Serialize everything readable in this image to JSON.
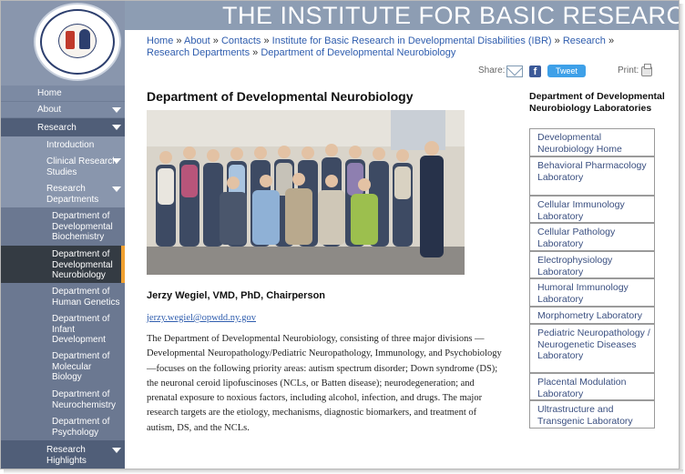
{
  "header": {
    "title": "THE INSTITUTE FOR BASIC RESEARCH"
  },
  "logo": {
    "text": "EDUCATION · RESEARCH · SERVICE · OPWDD"
  },
  "sidebar": {
    "items": [
      {
        "label": "Home"
      },
      {
        "label": "About"
      },
      {
        "label": "Research"
      },
      {
        "label": "Introduction"
      },
      {
        "label": "Clinical Research Studies"
      },
      {
        "label": "Research Departments"
      },
      {
        "label": "Department of Developmental Biochemistry"
      },
      {
        "label": "Department of Developmental Neurobiology"
      },
      {
        "label": "Department of Human Genetics"
      },
      {
        "label": "Department of Infant Development"
      },
      {
        "label": "Department of Molecular Biology"
      },
      {
        "label": "Department of Neurochemistry"
      },
      {
        "label": "Department of Psychology"
      },
      {
        "label": "Research Highlights"
      }
    ]
  },
  "breadcrumb": {
    "items": [
      "Home",
      "About",
      "Contacts",
      "Institute for Basic Research in Developmental Disabilities (IBR)",
      "Research",
      "Research Departments",
      "Department of Developmental Neurobiology"
    ],
    "separator": "»"
  },
  "share": {
    "label": "Share:",
    "tweet": "Tweet",
    "print": "Print:"
  },
  "main": {
    "title": "Department of Developmental Neurobiology",
    "chair": "Jerzy Wegiel, VMD, PhD, Chairperson",
    "email": "jerzy.wegiel@opwdd.ny.gov",
    "body": "The Department of Developmental Neurobiology, consisting of three major divisions —Developmental Neuropathology/Pediatric Neuropathology, Immunology, and Psychobiology—focuses on the following priority areas: autism spectrum disorder; Down syndrome (DS); the neuronal ceroid lipofuscinoses (NCLs, or Batten disease); neurodegeneration; and prenatal exposure to noxious factors, including alcohol, infection, and drugs. The major research targets are the etiology, mechanisms, diagnostic biomarkers, and treatment of autism, DS, and the NCLs."
  },
  "labs": {
    "heading": "Department of Developmental Neurobiology Laboratories",
    "items": [
      "Developmental Neurobiology Home",
      "Behavioral Pharmacology Laboratory",
      "Cellular Immunology Laboratory",
      "Cellular Pathology Laboratory",
      "Electrophysiology Laboratory",
      "Humoral Immunology Laboratory",
      "Morphometry Laboratory",
      "Pediatric Neuropathology / Neurogenetic Diseases Laboratory",
      "Placental Modulation Laboratory",
      "Ultrastructure and Transgenic Laboratory"
    ]
  },
  "colors": {
    "sidebar": "#8996ad",
    "active": "#343b43",
    "accent": "#f0a030",
    "link": "#2f5dae"
  }
}
